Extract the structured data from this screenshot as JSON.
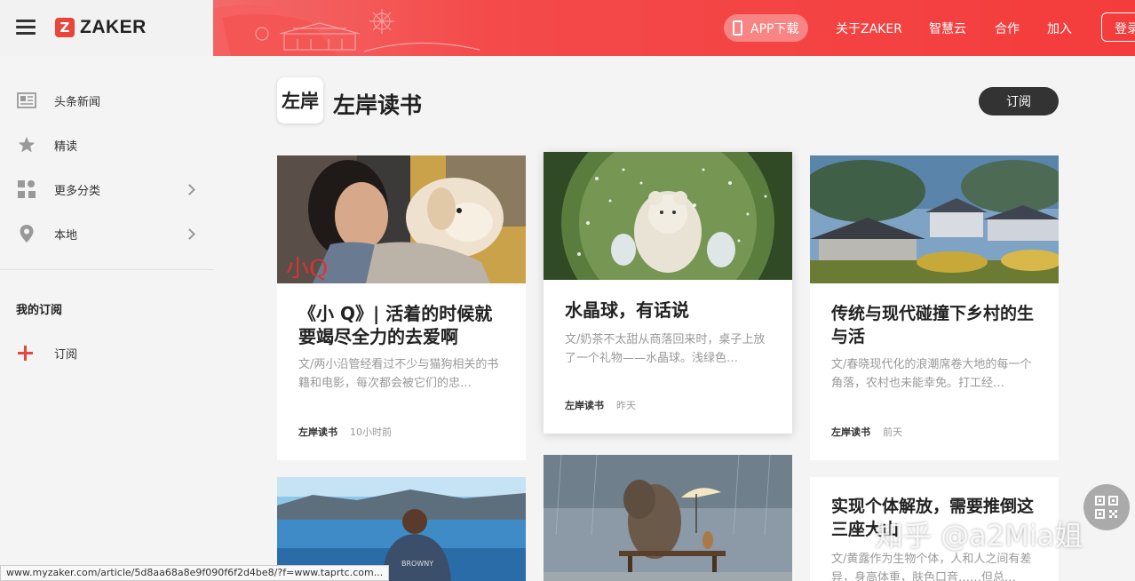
{
  "header": {
    "logo_mark": "Z",
    "logo_text": "ZAKER",
    "app_download": "APP下载",
    "nav": [
      "关于ZAKER",
      "智慧云",
      "合作",
      "加入"
    ],
    "login": "登录"
  },
  "sidebar": {
    "items": [
      {
        "label": "头条新闻",
        "icon": "newspaper-icon"
      },
      {
        "label": "精读",
        "icon": "star-icon"
      },
      {
        "label": "更多分类",
        "icon": "grid-icon",
        "chevron": true
      },
      {
        "label": "本地",
        "icon": "location-pin-icon",
        "chevron": true
      }
    ],
    "subscriptions_heading": "我的订阅",
    "subscribe_label": "订阅"
  },
  "channel": {
    "logo_text": "左岸",
    "title": "左岸读书",
    "subscribe_button": "订阅"
  },
  "articles": [
    {
      "title": "《小 Q》| 活着的时候就要竭尽全力的去爱啊",
      "summary": "文/两小沿管经看过不少与猫狗相关的书籍和电影，每次都会被它们的忠…",
      "source": "左岸读书",
      "time": "10小时前"
    },
    {
      "title": "水晶球，有话说",
      "summary": "文/奶茶不太甜从商落回来时，桌子上放了一个礼物——水晶球。浅绿色…",
      "source": "左岸读书",
      "time": "昨天"
    },
    {
      "title": "传统与现代碰撞下乡村的生与活",
      "summary": "文/春晓现代化的浪潮席卷大地的每一个角落，农村也未能幸免。打工经…",
      "source": "左岸读书",
      "time": "前天"
    },
    {
      "title": "实现个体解放，需要推倒这三座大山",
      "summary": "文/黄露作为生物个体，人和人之间有差异，身高体重，肤色口音……但总…"
    }
  ],
  "status_url": "www.myzaker.com/article/5d8aa68a8e9f090f6f2d4be8/?f=www.taprtc.com...",
  "watermark": "知乎 @a2Mia姐",
  "colors": {
    "brand_red": "#e8453c",
    "banner_red": "#f43c3c",
    "button_dark": "#333333"
  }
}
